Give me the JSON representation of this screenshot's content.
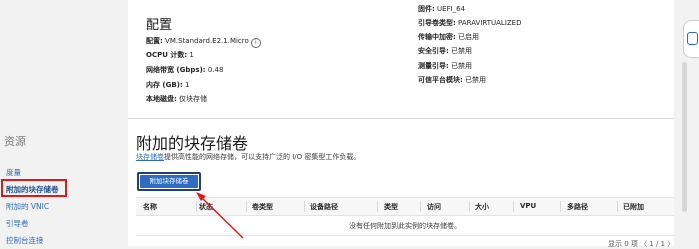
{
  "sidebar": {
    "title": "资源",
    "items": [
      {
        "label": "度量",
        "active": false
      },
      {
        "label": "附加的块存储卷",
        "active": true
      },
      {
        "label": "附加的 VNIC",
        "active": false
      },
      {
        "label": "引导卷",
        "active": false
      },
      {
        "label": "控制台连接",
        "active": false
      }
    ]
  },
  "config": {
    "heading": "配置",
    "shape_label": "配置:",
    "shape_value": "VM.Standard.E2.1.Micro",
    "ocpu_label": "OCPU 计数:",
    "ocpu_value": "1",
    "bandwidth_label": "网络带宽 (Gbps):",
    "bandwidth_value": "0.48",
    "memory_label": "内存 (GB):",
    "memory_value": "1",
    "local_disk_label": "本地磁盘:",
    "local_disk_value": "仅块存储"
  },
  "right_info": {
    "firmware_label": "固件:",
    "firmware_value": "UEFI_64",
    "boot_volume_type_label": "引导卷类型:",
    "boot_volume_type_value": "PARAVIRTUALIZED",
    "in_transit_label": "传输中加密:",
    "in_transit_value": "已启用",
    "secure_boot_label": "安全引导:",
    "secure_boot_value": "已禁用",
    "measured_boot_label": "测量引导:",
    "measured_boot_value": "已禁用",
    "trusted_platform_label": "可信平台模块:",
    "trusted_platform_value": "已禁用"
  },
  "attached": {
    "heading": "附加的块存储卷",
    "desc_link": "块存储卷",
    "desc_rest": "提供高性能的网络存储，可以支持广泛的 I/O 密集型工作负载。",
    "attach_button": "附加块存储卷"
  },
  "table": {
    "headers": [
      "名称",
      "状态",
      "卷类型",
      "设备路径",
      "类型",
      "访问",
      "大小",
      "VPU",
      "多路径",
      "已附加"
    ],
    "empty_text": "没有任何附加到此实例的块存储卷。",
    "pager": "显示 0 项 〈 1 / 1 〉"
  },
  "colors": {
    "link": "#2a6ebb",
    "primary_button": "#2d6cc0",
    "highlight": "#e01a1a"
  }
}
